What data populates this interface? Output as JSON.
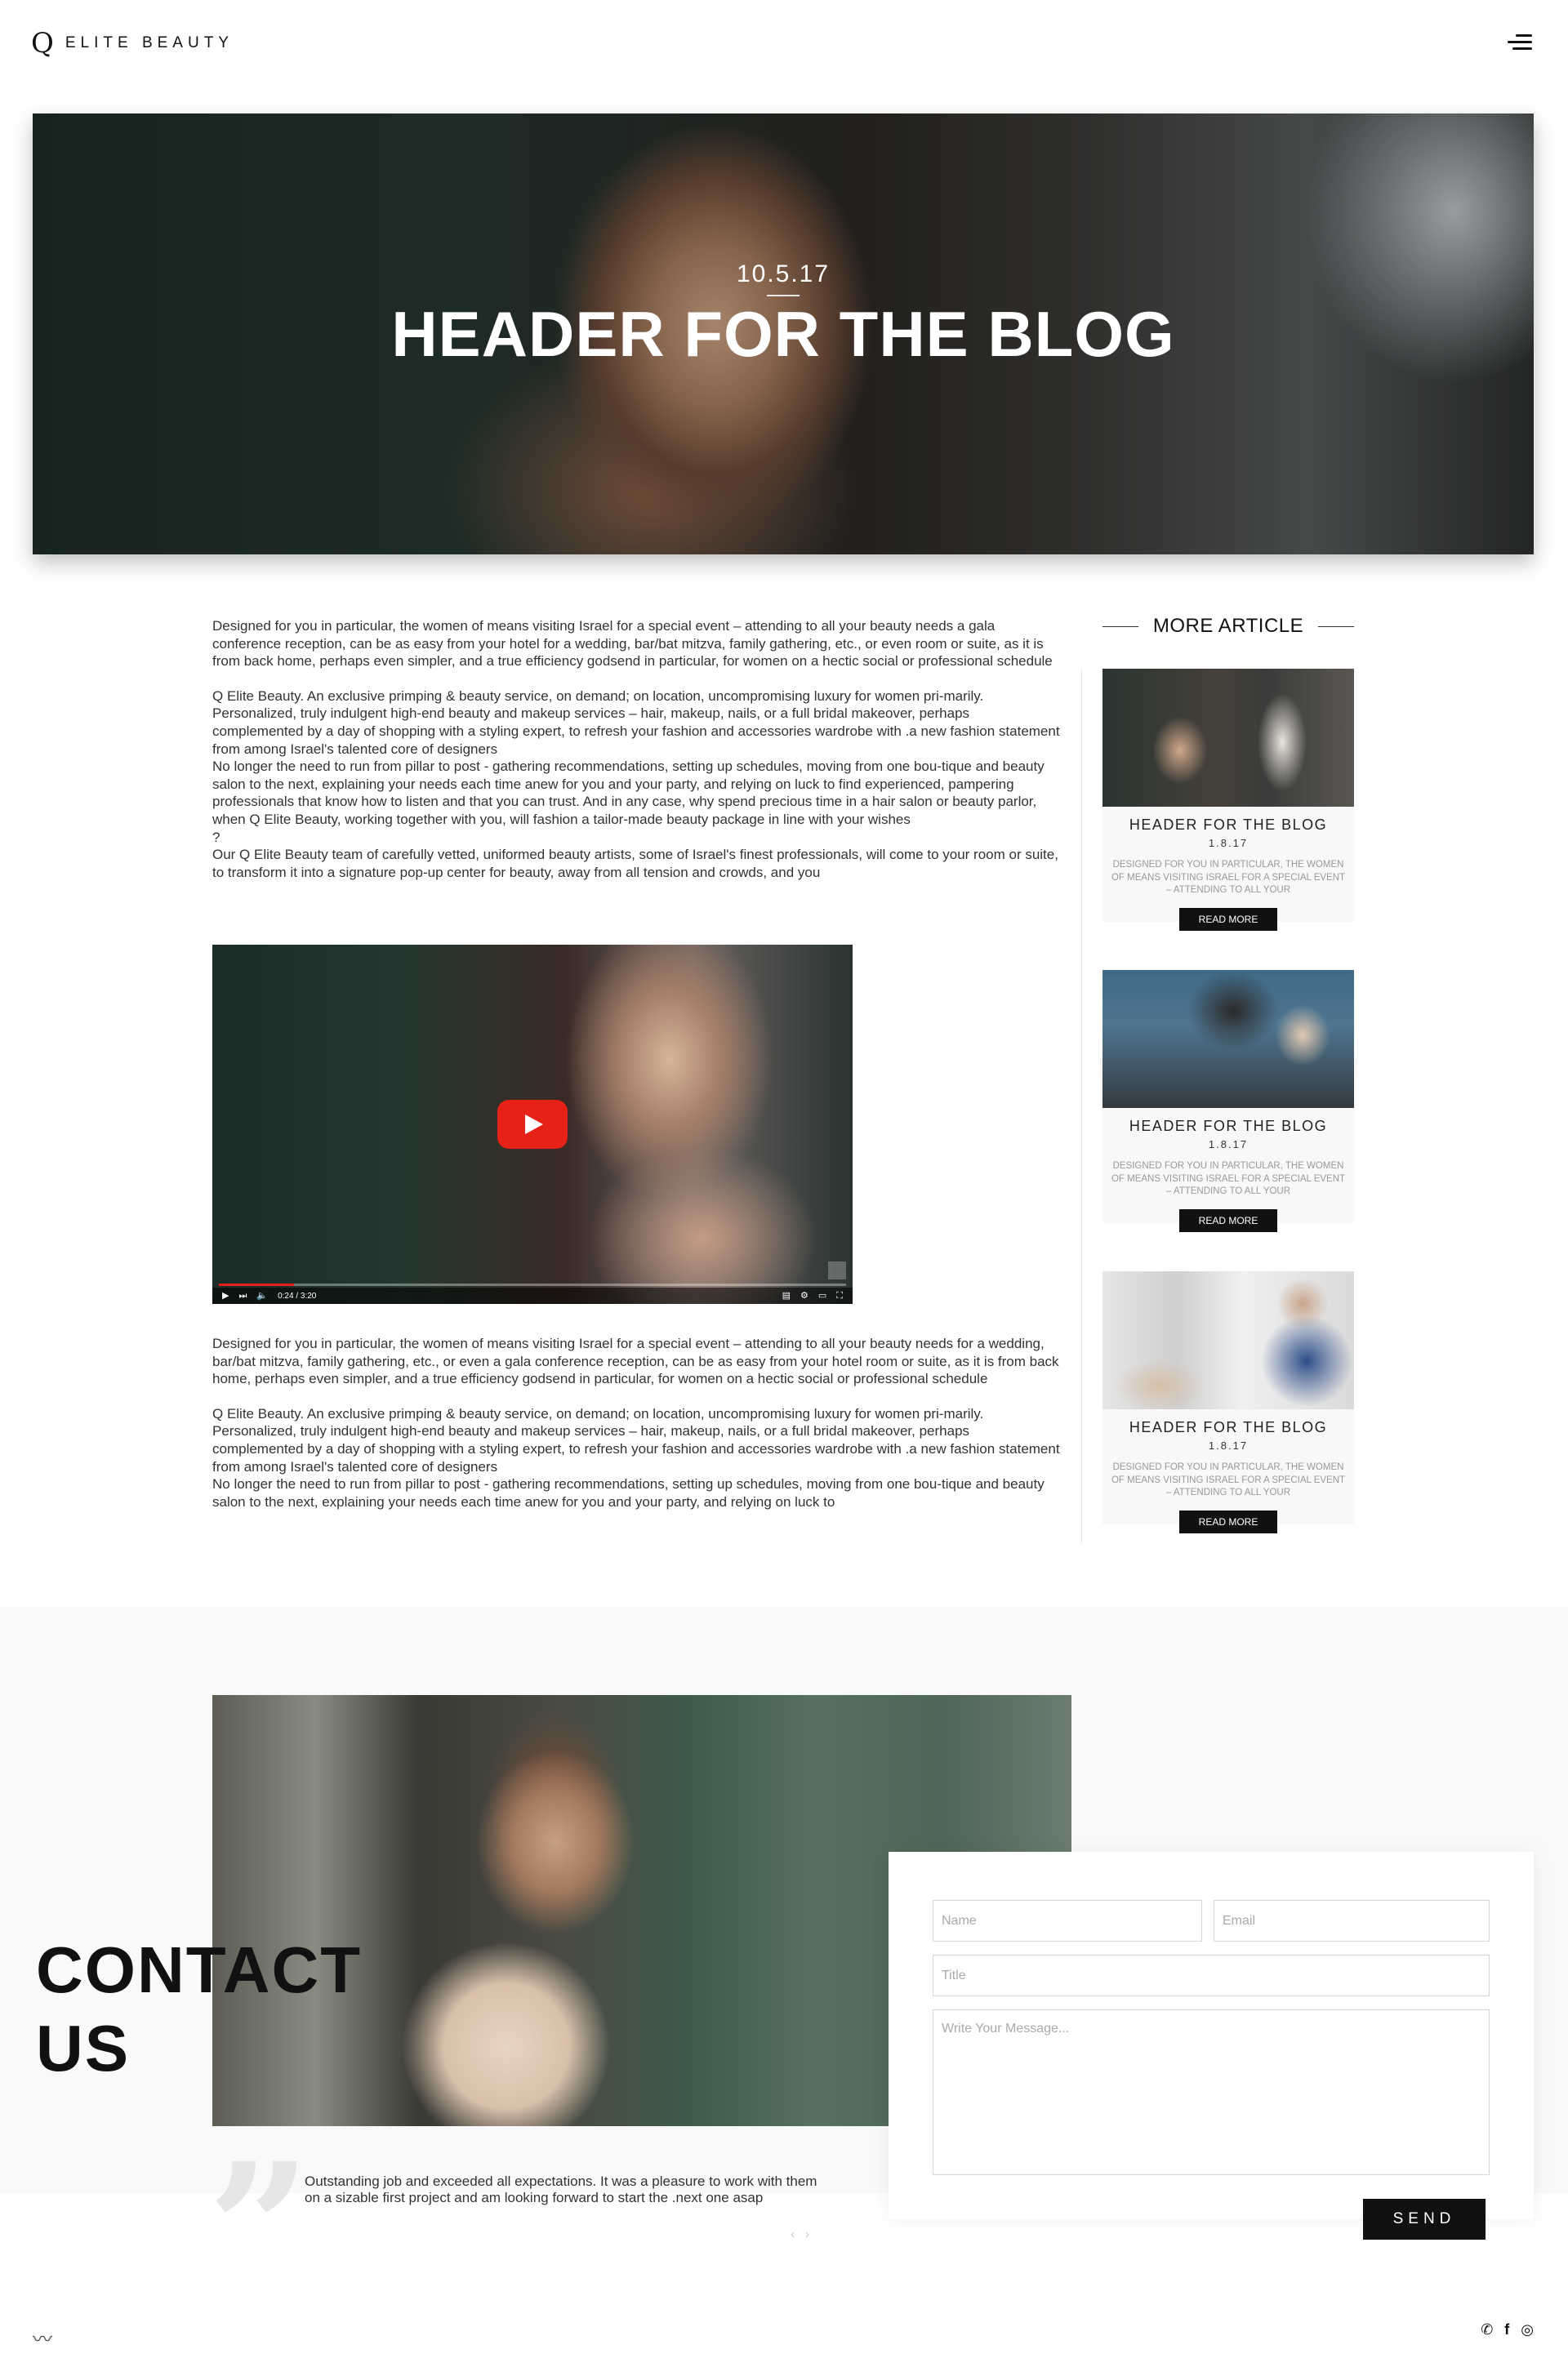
{
  "header": {
    "brand_mark": "Q",
    "brand_name": "ELITE BEAUTY"
  },
  "hero": {
    "date": "10.5.17",
    "title": "HEADER FOR THE BLOG"
  },
  "article": {
    "paragraphs": [
      "Designed for you in particular, the women of means visiting Israel for a special event – attending to all your beauty needs a gala conference reception, can be as easy from your hotel ‫for a wedding, bar/bat mitzva, family gathering, etc., or even room or suite, as it is from back home, perhaps even simpler, and a true efficiency godsend in particular, for women on a hectic social or professional schedule",
      "Q Elite Beauty. An exclusive primping & beauty service, on demand; on location, uncompromising luxury for women pri-marily. Personalized, truly indulgent high-end beauty and makeup services – hair, makeup, nails, or a full bridal makeover, perhaps complemented by a day of shopping with a styling expert, to refresh your fashion and accessories wardrobe with .a new fashion statement from among Israel's talented core of designers",
      "No longer the need to run from pillar to post - gathering recommendations, setting up schedules, moving from one bou-tique and beauty salon to the next, explaining your needs each time anew for you and your party, and relying on luck to find experienced, pampering professionals that know how to listen and that you can trust. And in any case, why spend precious time in a hair salon or beauty parlor, when Q Elite Beauty, working together with you, will fashion a tailor-made beauty package in line with your wishes",
      "?",
      "Our Q Elite Beauty team of carefully vetted, uniformed beauty artists, some of Israel's finest professionals, will come to your room or suite, to transform it into a signature pop-up center for beauty, away from all tension and crowds, and you"
    ],
    "video": {
      "time": "0:24 / 3:20",
      "progress": 0.12
    },
    "paragraphs_after": [
      "Designed for you in particular, the women of means visiting Israel for a special event – attending to all your beauty needs for a wedding, bar/bat mitzva, family gathering, etc., or even a gala conference reception, can be as easy from your hotel room or suite, as it is from back home, perhaps even simpler, and a true efficiency godsend in particular, for women on a hectic social or professional schedule",
      "Q Elite Beauty. An exclusive primping & beauty service, on demand; on location, uncompromising luxury for women pri-marily. Personalized, truly indulgent high-end beauty and makeup services – hair, makeup, nails, or a full bridal makeover, perhaps complemented by a day of shopping with a styling expert, to refresh your fashion and accessories wardrobe with .a new fashion statement from among Israel's talented core of designers",
      "No longer the need to run from pillar to post - gathering recommendations, setting up schedules, moving from one bou-tique and beauty salon to the next, explaining your needs each time anew for you and your party, and relying on luck to"
    ]
  },
  "sidebar": {
    "heading": "MORE ARTICLE",
    "cards": [
      {
        "title": "HEADER FOR THE BLOG",
        "date": "1.8.17",
        "excerpt": "Designed for you in particular, the women of means visiting Israel for a special event – attending to all your",
        "button": "READ MORE"
      },
      {
        "title": "HEADER FOR THE BLOG",
        "date": "1.8.17",
        "excerpt": "Designed for you in particular, the women of means visiting Israel for a special event – attending to all your",
        "button": "READ MORE"
      },
      {
        "title": "HEADER FOR THE BLOG",
        "date": "1.8.17",
        "excerpt": "Designed for you in particular, the women of means visiting Israel for a special event – attending to all your",
        "button": "READ MORE"
      }
    ]
  },
  "contact": {
    "title_line1": "CONTACT",
    "title_line2": "US",
    "form": {
      "name_placeholder": "Name",
      "email_placeholder": "Email",
      "title_placeholder": "Title",
      "message_placeholder": "Write Your Message...",
      "send_label": "SEND"
    },
    "testimonial": {
      "quote_mark": "”",
      "text": "Outstanding job and exceeded all expectations. It was a pleasure to work with them on a sizable first project and am looking forward to start the .next one asap",
      "nav": "‹ ›"
    }
  },
  "footer": {
    "wave_icon": "〰",
    "social": [
      "whatsapp-icon",
      "facebook-icon",
      "instagram-icon"
    ]
  },
  "colors": {
    "accent": "#111111",
    "youtube_red": "#e62117"
  }
}
